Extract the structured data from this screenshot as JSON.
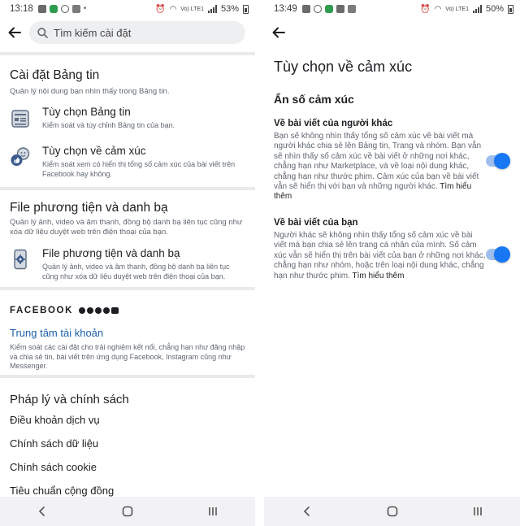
{
  "left": {
    "status": {
      "time": "13:18",
      "network": "Vo) LTE1",
      "battery": "53%"
    },
    "search": {
      "placeholder": "Tìm kiếm cài đặt"
    },
    "news_feed": {
      "title": "Cài đặt Bảng tin",
      "subtitle": "Quản lý nội dung bạn nhìn thấy trong Bảng tin.",
      "items": [
        {
          "label": "Tùy chọn Bảng tin",
          "desc": "Kiểm soát và tùy chỉnh Bảng tin của bạn.",
          "icon": "news-feed-icon"
        },
        {
          "label": "Tùy chọn về cảm xúc",
          "desc": "Kiểm soát xem có hiển thị tổng số cảm xúc của bài viết trên Facebook hay không.",
          "icon": "reactions-icon"
        }
      ]
    },
    "media": {
      "title": "File phương tiện và danh bạ",
      "subtitle": "Quản lý ảnh, video và âm thanh, đồng bộ danh bạ liên tục cũng như xóa dữ liệu duyệt web trên điện thoại của bạn.",
      "items": [
        {
          "label": "File phương tiện và danh bạ",
          "desc": "Quản lý ảnh, video và âm thanh, đồng bộ danh bạ liên tục cũng như xóa dữ liệu duyệt web trên điện thoại của bạn.",
          "icon": "phone-settings-icon"
        }
      ]
    },
    "facebook": {
      "brand": "FACEBOOK",
      "accounts_center": "Trung tâm tài khoản",
      "accounts_desc": "Kiểm soát các cài đặt cho trải nghiệm kết nối, chẳng hạn như đăng nhập và chia sẻ tin, bài viết trên ứng dụng Facebook, Instagram cũng như Messenger."
    },
    "legal": {
      "title": "Pháp lý và chính sách",
      "rows": [
        "Điều khoản dịch vụ",
        "Chính sách dữ liệu",
        "Chính sách cookie",
        "Tiêu chuẩn cộng đồng"
      ]
    }
  },
  "right": {
    "status": {
      "time": "13:49",
      "network": "Vo) LTE1",
      "battery": "50%"
    },
    "title": "Tùy chọn về cảm xúc",
    "subtitle": "Ẩn số cảm xúc",
    "options": [
      {
        "title": "Về bài viết của người khác",
        "desc": "Bạn sẽ không nhìn thấy tổng số cảm xúc về bài viết mà người khác chia sẻ lên Bảng tin, Trang và nhóm. Bạn vẫn sẽ nhìn thấy số cảm xúc về bài viết ở những nơi khác, chẳng hạn như Marketplace, và về loại nội dung khác, chẳng hạn như thước phim. Cảm xúc của bạn về bài viết vẫn sẽ hiển thị với bạn và những người khác.",
        "more": "Tìm hiểu thêm",
        "enabled": true
      },
      {
        "title": "Về bài viết của bạn",
        "desc": "Người khác sẽ không nhìn thấy tổng số cảm xúc về bài viết mà bạn chia sẻ lên trang cá nhân của mình. Số cảm xúc vẫn sẽ hiển thị trên bài viết của bạn ở những nơi khác, chẳng hạn như nhóm, hoặc trên loại nội dung khác, chẳng hạn như thước phim.",
        "more": "Tìm hiểu thêm",
        "enabled": true
      }
    ]
  },
  "colors": {
    "accent": "#1877f2",
    "link": "#1b5fa8",
    "toggle_track": "#9fc0ee",
    "divider": "#e9eaec"
  }
}
